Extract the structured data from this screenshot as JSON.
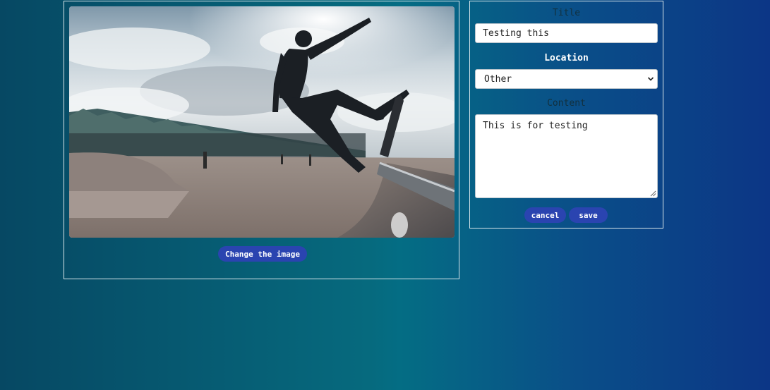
{
  "image_panel": {
    "change_button_label": "Change the image",
    "photo_subject": "skateboarder-photo"
  },
  "form": {
    "title_label": "Title",
    "title_value": "Testing this",
    "location_label": "Location",
    "location_value": "Other",
    "content_label": "Content",
    "content_value": "This is for testing",
    "cancel_label": "cancel",
    "save_label": "save"
  },
  "colors": {
    "button": "#2a44b0",
    "panel_border": "#d9e6ea",
    "background_left": "#064863",
    "background_mid": "#066a7e",
    "background_right": "#0c3686"
  }
}
